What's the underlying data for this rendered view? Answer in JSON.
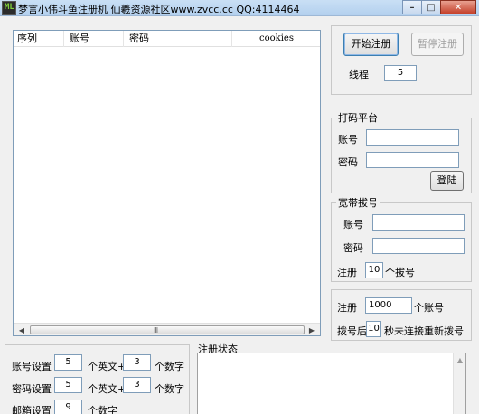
{
  "window": {
    "title": "梦言小伟斗鱼注册机  仙羲资源社区www.zvcc.cc QQ:4114464",
    "icon_text": "ML",
    "minimize_icon": "minimize-icon",
    "maximize_icon": "maximize-icon",
    "close_icon": "close-icon"
  },
  "list": {
    "columns": [
      "序列",
      "账号",
      "密码",
      "cookies"
    ],
    "rows": [],
    "scroll_grip": "III"
  },
  "controls": {
    "start_label": "开始注册",
    "pause_label": "暂停注册",
    "threads_label": "线程",
    "threads_value": "5"
  },
  "captcha": {
    "title": "打码平台",
    "account_label": "账号",
    "account_value": "",
    "password_label": "密码",
    "password_value": "",
    "login_label": "登陆"
  },
  "broadband": {
    "title": "宽带拔号",
    "account_label": "账号",
    "account_value": "",
    "password_label": "密码",
    "password_value": "",
    "register_label": "注册",
    "register_value": "10",
    "dial_suffix": "个拔号"
  },
  "redial": {
    "register_label": "注册",
    "register_value": "1000",
    "count_suffix": "个账号",
    "after_label": "拨号后",
    "after_value": "10",
    "after_suffix": "秒未连接重新拨号"
  },
  "settings": {
    "account_label": "账号设置",
    "account_letters": "5",
    "account_letters_suffix": "个英文+",
    "account_digits": "3",
    "account_digits_suffix": "个数字",
    "password_label": "密码设置",
    "password_letters": "5",
    "password_letters_suffix": "个英文+",
    "password_digits": "3",
    "password_digits_suffix": "个数字",
    "email_label": "邮箱设置",
    "email_digits": "9",
    "email_suffix": "个数字"
  },
  "status": {
    "title": "注册状态",
    "text": ""
  }
}
